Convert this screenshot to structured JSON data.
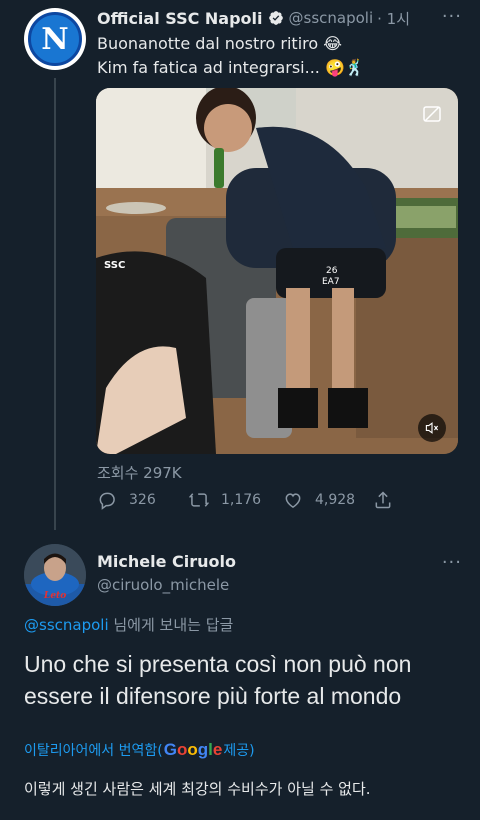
{
  "tweet": {
    "author_name": "Official SSC Napoli",
    "avatar_letter": "N",
    "handle": "@sscnapoli",
    "time": "· 1시",
    "more": "···",
    "line1": "Buonanotte dal nostro ritiro 😂",
    "line2": "Kim fa fatica ad integrarsi... 🤪🕺",
    "views": "조회수 297K",
    "replies": "326",
    "retweets": "1,176",
    "likes": "4,928",
    "player_number": "26",
    "shirt_brand": "EA7",
    "media_sticker": "SSC"
  },
  "reply": {
    "author_name": "Michele Ciruolo",
    "handle": "@ciruolo_michele",
    "more": "···",
    "jersey_text": "Leto",
    "reply_mention": "@sscnapoli",
    "reply_suffix": " 님에게 보내는 답글",
    "text": "Uno che si presenta così non può non essere il difensore più forte al mondo",
    "translate_prefix": "이탈리아어에서 번역함(",
    "translate_google": "Google",
    "translate_suffix": " 제공)",
    "translated_text": "이렇게 생긴 사람은 세계 최강의 수비수가 아닐 수 없다."
  },
  "colors": {
    "background": "#15202b",
    "accent": "#1d9bf0",
    "muted": "#8b98a5",
    "text": "#e7e9ea"
  }
}
